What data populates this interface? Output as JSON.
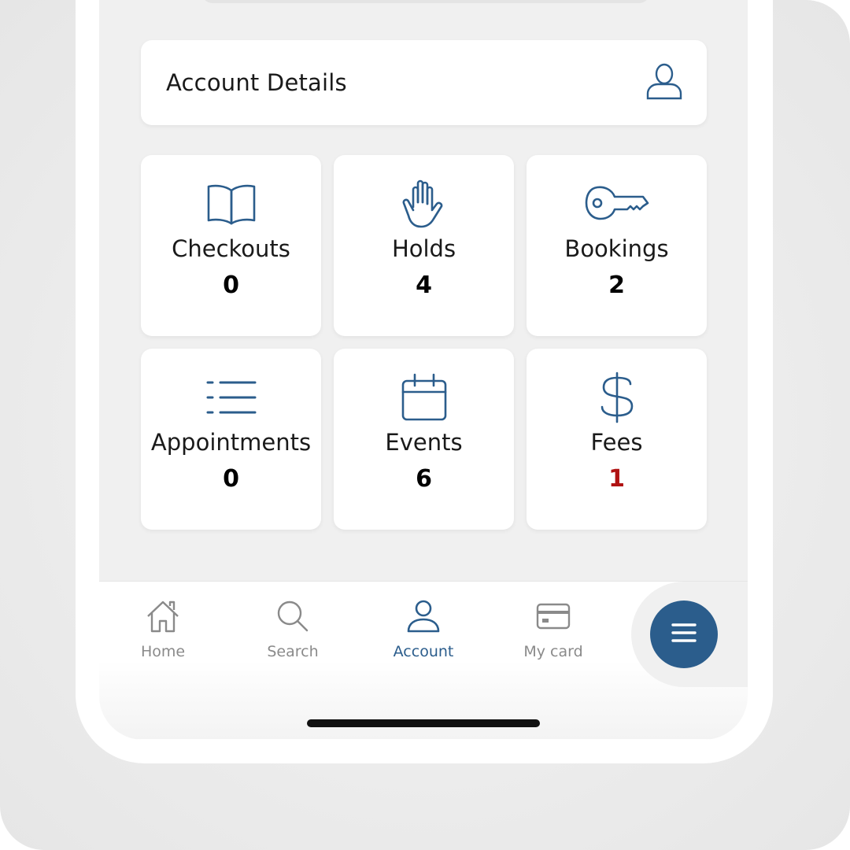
{
  "account_details": {
    "label": "Account Details",
    "icon": "user-icon"
  },
  "tiles": [
    {
      "label": "Checkouts",
      "count": "0",
      "icon": "book-icon"
    },
    {
      "label": "Holds",
      "count": "4",
      "icon": "hand-icon"
    },
    {
      "label": "Bookings",
      "count": "2",
      "icon": "key-icon"
    },
    {
      "label": "Appointments",
      "count": "0",
      "icon": "list-icon"
    },
    {
      "label": "Events",
      "count": "6",
      "icon": "calendar-icon"
    },
    {
      "label": "Fees",
      "count": "1",
      "icon": "dollar-icon",
      "count_color": "#b01212"
    }
  ],
  "tabbar": {
    "items": [
      {
        "label": "Home",
        "icon": "home-icon",
        "active": false
      },
      {
        "label": "Search",
        "icon": "search-icon",
        "active": false
      },
      {
        "label": "Account",
        "icon": "account-icon",
        "active": true
      },
      {
        "label": "My card",
        "icon": "card-icon",
        "active": false
      }
    ],
    "menu_icon": "menu-icon"
  },
  "colors": {
    "accent": "#2b5d8c",
    "alert": "#b01212",
    "inactive": "#8a8a8a"
  }
}
